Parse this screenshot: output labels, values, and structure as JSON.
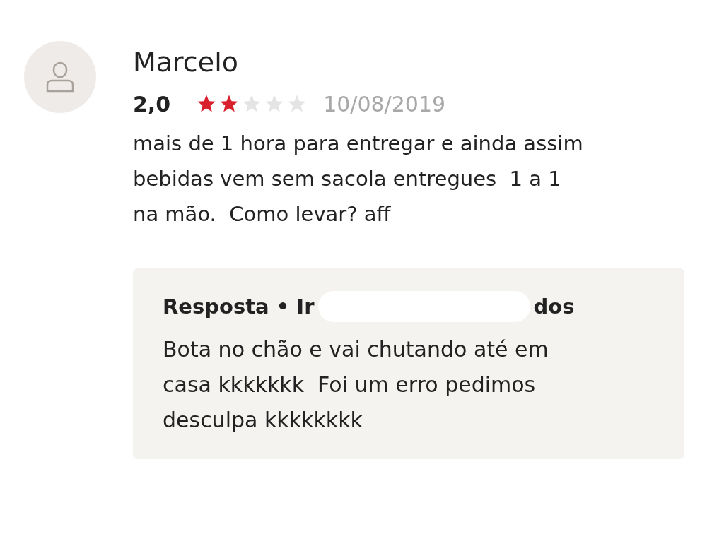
{
  "review": {
    "author": "Marcelo",
    "rating": "2,0",
    "stars": 2,
    "date": "10/08/2019",
    "text": "mais de 1 hora para entregar e ainda assim bebidas vem sem sacola entregues  1 a 1 na mão.  Como levar? aff"
  },
  "reply": {
    "title_start": "Resposta • Ir",
    "title_end": "dos",
    "text": "Bota no chão e vai chutando até em casa kkkkkkk  Foi um erro pedimos desculpa kkkkkkkk"
  }
}
